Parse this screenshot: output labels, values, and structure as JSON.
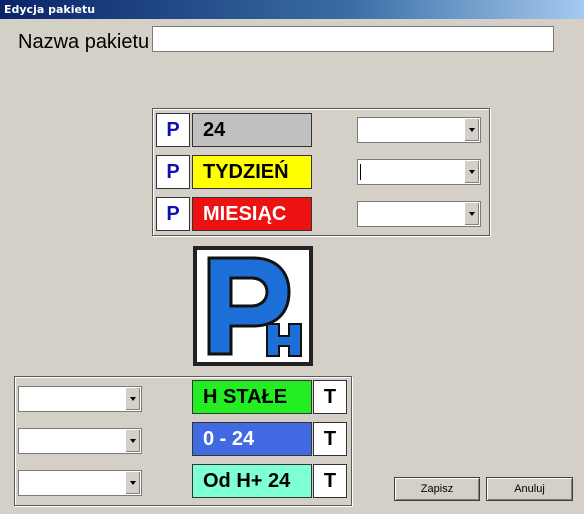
{
  "window": {
    "title": "Edycja pakietu"
  },
  "name_field": {
    "label": "Nazwa pakietu",
    "value": ""
  },
  "tickets_top": [
    {
      "p_label": "P",
      "text": "24",
      "bg": "#c0c0c0",
      "fg": "#000000",
      "combo_value": ""
    },
    {
      "p_label": "P",
      "text": "TYDZIEŃ",
      "bg": "#ffff00",
      "fg": "#000000",
      "combo_value": ""
    },
    {
      "p_label": "P",
      "text": "MIESIĄC",
      "bg": "#ee1111",
      "fg": "#ffffff",
      "combo_value": ""
    }
  ],
  "logo": {
    "icon": "parking-h-icon",
    "letter": "P",
    "subletter": "H",
    "color": "#1c6fd6"
  },
  "tickets_bottom": [
    {
      "text": "H STAŁE",
      "bg": "#22ee22",
      "fg": "#000000",
      "t_label": "T",
      "combo_value": ""
    },
    {
      "text": "0 - 24",
      "bg": "#4169e1",
      "fg": "#ffffff",
      "t_label": "T",
      "combo_value": ""
    },
    {
      "text": "Od H+ 24",
      "bg": "#7fffd4",
      "fg": "#000000",
      "t_label": "T",
      "combo_value": ""
    }
  ],
  "buttons": {
    "save": "Zapisz",
    "cancel": "Anuluj"
  }
}
